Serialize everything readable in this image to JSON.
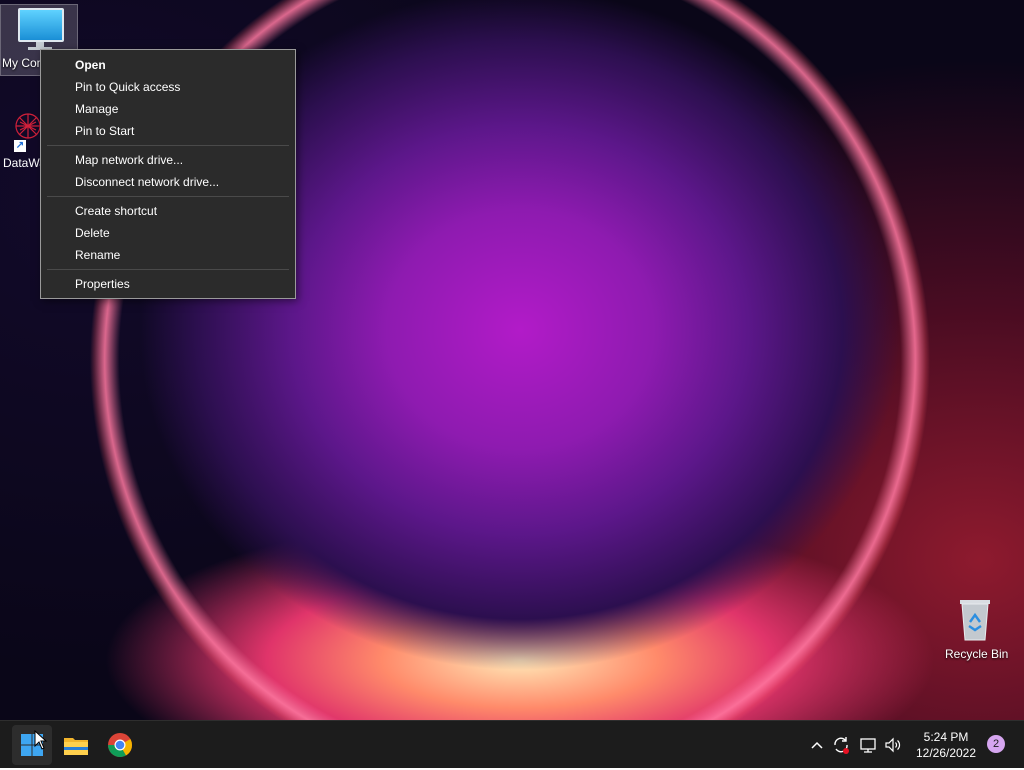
{
  "desktop": {
    "icons": [
      {
        "label": "My Computer",
        "visible_label": "My Com"
      },
      {
        "label": "DataWa"
      },
      {
        "label": "Recycle Bin"
      }
    ]
  },
  "context_menu": {
    "groups": [
      [
        "Open",
        "Pin to Quick access",
        "Manage",
        "Pin to Start"
      ],
      [
        "Map network drive...",
        "Disconnect network drive..."
      ],
      [
        "Create shortcut",
        "Delete",
        "Rename"
      ],
      [
        "Properties"
      ]
    ],
    "items": {
      "open": "Open",
      "pin_quick_access": "Pin to Quick access",
      "manage": "Manage",
      "pin_start": "Pin to Start",
      "map_drive": "Map network drive...",
      "disconnect_drive": "Disconnect network drive...",
      "create_shortcut": "Create shortcut",
      "delete": "Delete",
      "rename": "Rename",
      "properties": "Properties"
    }
  },
  "taskbar": {
    "apps": [
      {
        "name": "start",
        "icon": "windows-logo-icon"
      },
      {
        "name": "file-explorer",
        "icon": "folder-icon"
      },
      {
        "name": "chrome",
        "icon": "chrome-icon"
      }
    ],
    "tray": {
      "icons": [
        "chevron-up-icon",
        "sync-icon",
        "network-icon",
        "volume-icon"
      ],
      "time": "5:24 PM",
      "date": "12/26/2022",
      "notification_count": "2"
    }
  },
  "colors": {
    "menu_bg": "#2b2b2b",
    "taskbar_bg": "#1c1c1c",
    "badge": "#d6a6f0",
    "accent": "#0078d4"
  }
}
